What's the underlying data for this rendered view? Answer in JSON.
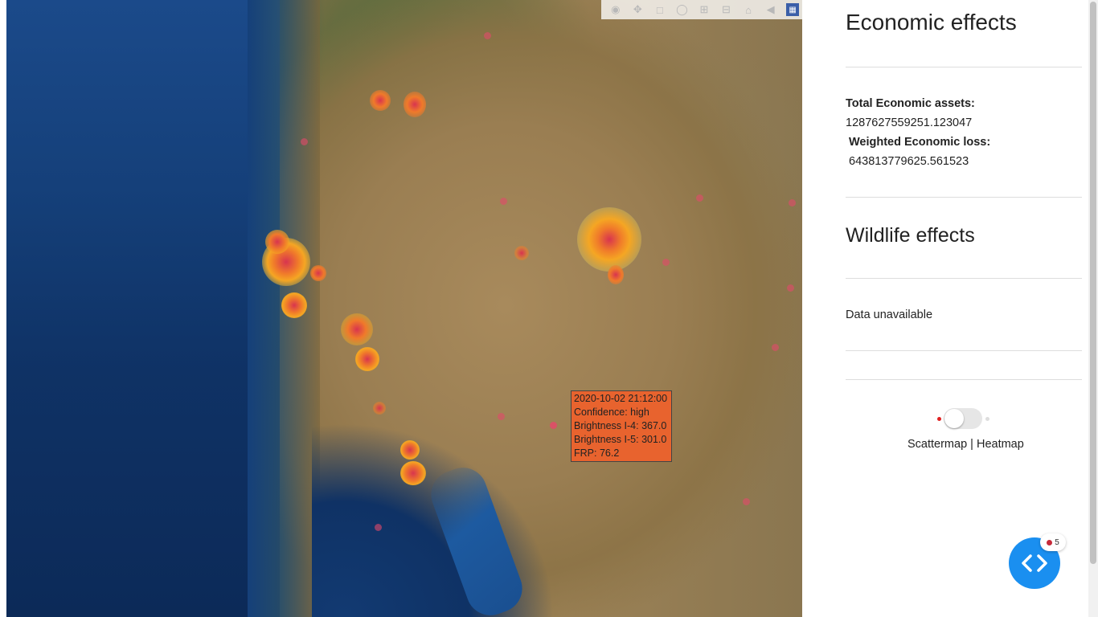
{
  "toolbar": {
    "buttons": [
      "camera-icon",
      "pan-icon",
      "box-select-icon",
      "lasso-icon",
      "zoom-in-icon",
      "zoom-out-icon",
      "home-icon",
      "reset-icon",
      "plotly-logo-icon"
    ]
  },
  "tooltip": {
    "date": "2020-10-02 21:12:00",
    "confidence": "Confidence: high",
    "brightness4": "Brightness I-4: 367.0",
    "brightness5": "Brightness I-5: 301.0",
    "frp": "FRP: 76.2"
  },
  "panel": {
    "economic_title": "Economic effects",
    "total_assets_label": "Total Economic assets:",
    "total_assets_value": "1287627559251.123047",
    "weighted_loss_label": "Weighted Economic loss:",
    "weighted_loss_value": "643813779625.561523",
    "wildlife_title": "Wildlife effects",
    "wildlife_text": "Data unavailable",
    "toggle_label": "Scattermap | Heatmap"
  },
  "dev_tools": {
    "badge_count": "5"
  },
  "colors": {
    "tooltip_bg": "#e8632e",
    "fire_dot": "#e34a6a",
    "dev_button": "#1a8ff0"
  }
}
